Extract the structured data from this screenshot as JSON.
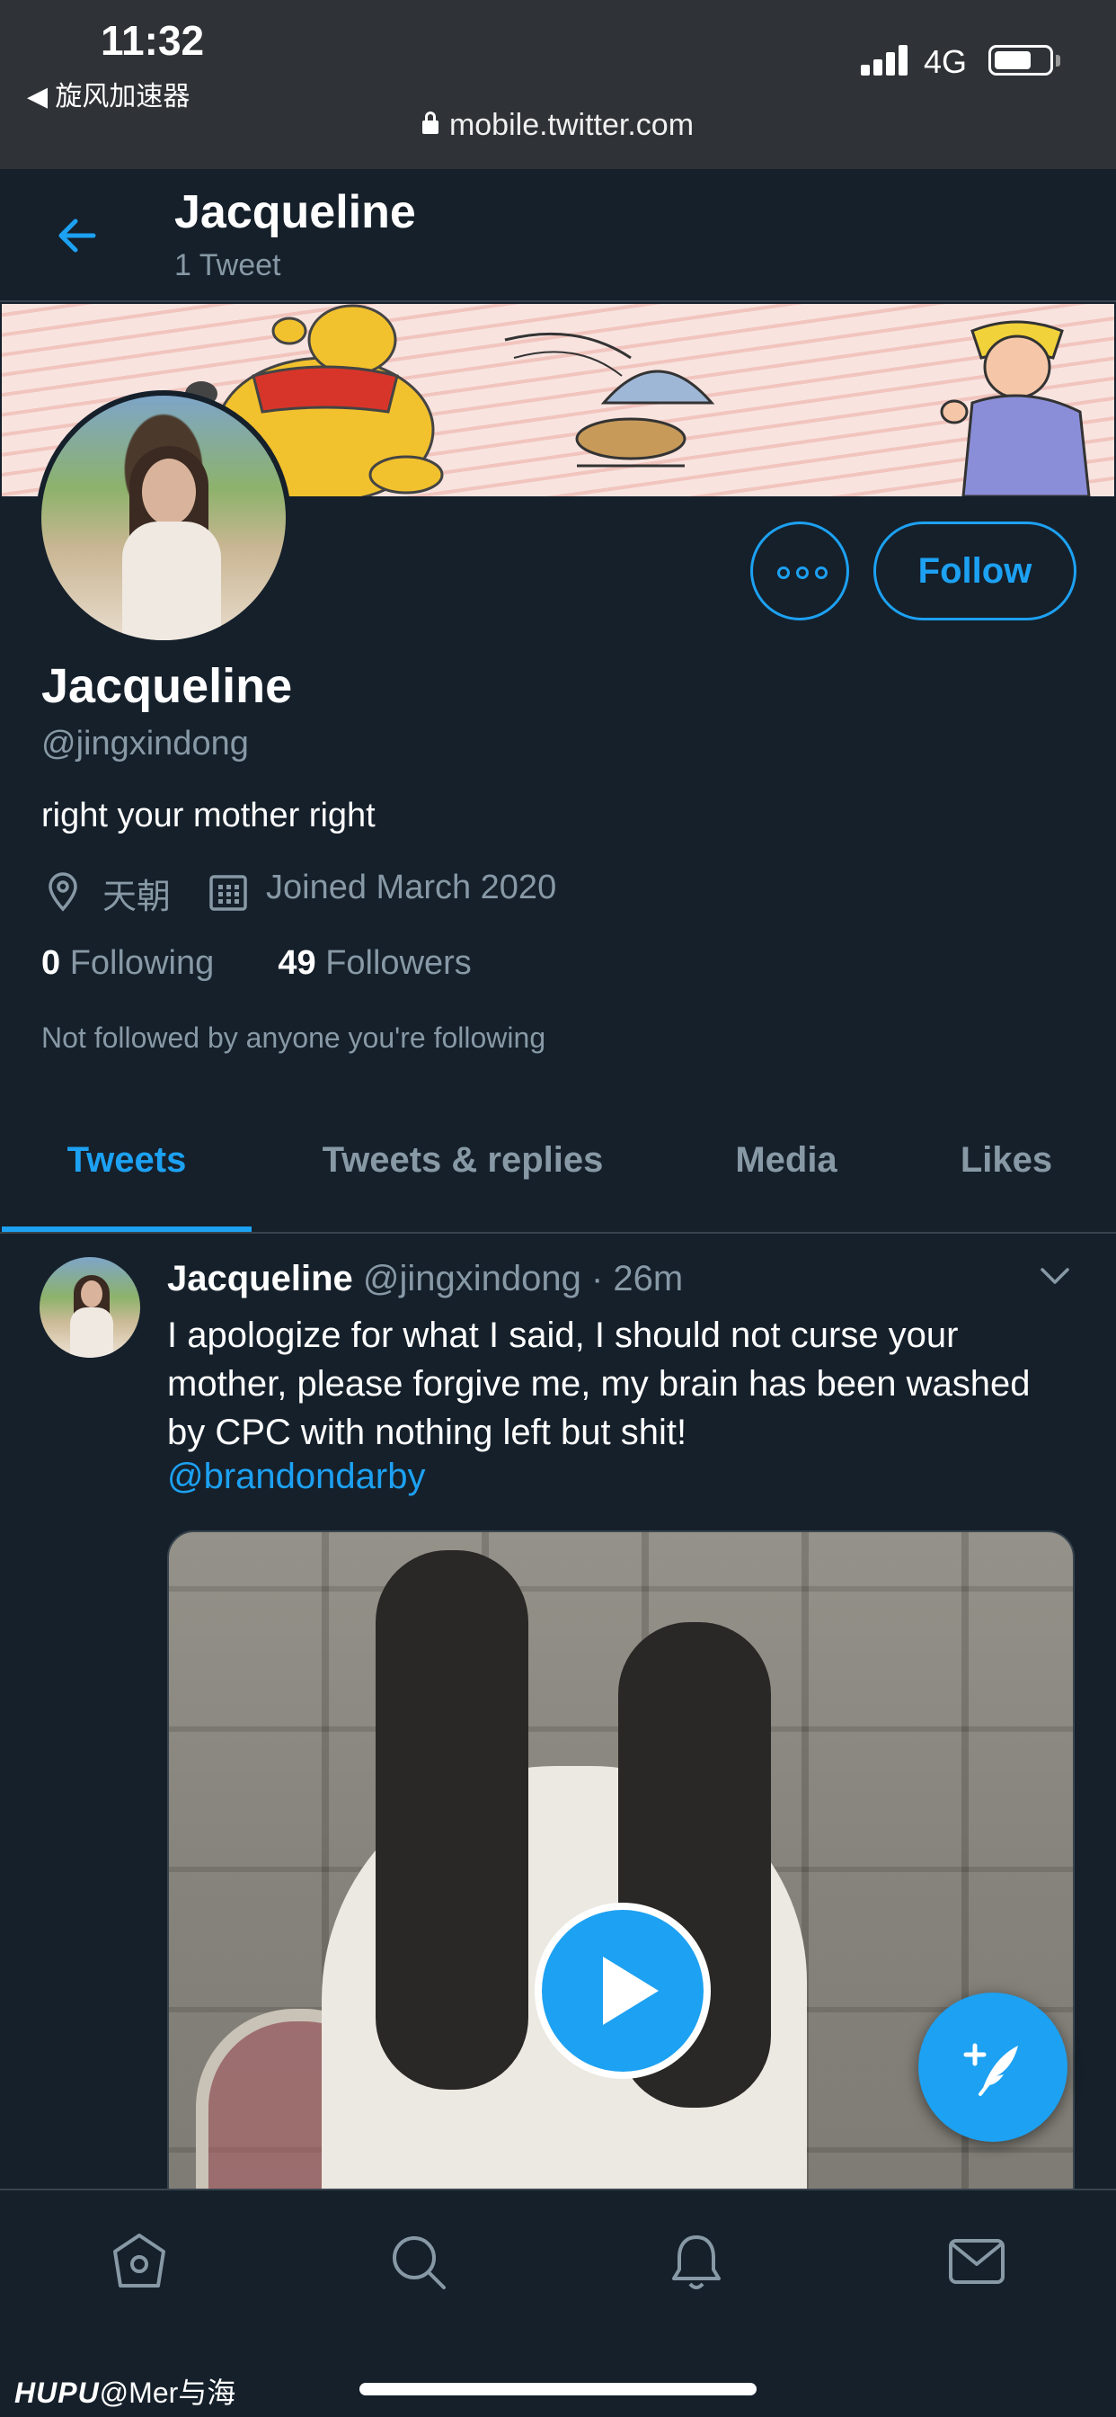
{
  "status_bar": {
    "time": "11:32",
    "back_app": "◀ 旋风加速器",
    "network": "4G",
    "url": "mobile.twitter.com"
  },
  "header": {
    "name": "Jacqueline",
    "tweet_count": "1 Tweet"
  },
  "profile": {
    "name": "Jacqueline",
    "handle": "@jingxindong",
    "bio": "right your mother right",
    "location": "天朝",
    "joined": "Joined March 2020",
    "following_count": "0",
    "following_label": "Following",
    "followers_count": "49",
    "followers_label": "Followers",
    "not_followed": "Not followed by anyone you're following",
    "follow_button": "Follow"
  },
  "tabs": [
    {
      "label": "Tweets",
      "active": true
    },
    {
      "label": "Tweets & replies",
      "active": false
    },
    {
      "label": "Media",
      "active": false
    },
    {
      "label": "Likes",
      "active": false
    }
  ],
  "tweet": {
    "name": "Jacqueline",
    "meta": " @jingxindong · 26m",
    "text": "I apologize for what I said, I should not curse your mother, please forgive me, my brain has been washed by CPC with nothing left but shit!",
    "mention": "@brandondarby"
  },
  "bottom_nav": [
    "home-icon",
    "search-icon",
    "notifications-icon",
    "messages-icon"
  ],
  "watermark": {
    "brand": "HUPU",
    "user": "@Mer与海"
  },
  "colors": {
    "background": "#15202b",
    "accent": "#1da1f2",
    "secondary_text": "#8899a6",
    "divider": "#38444d"
  }
}
